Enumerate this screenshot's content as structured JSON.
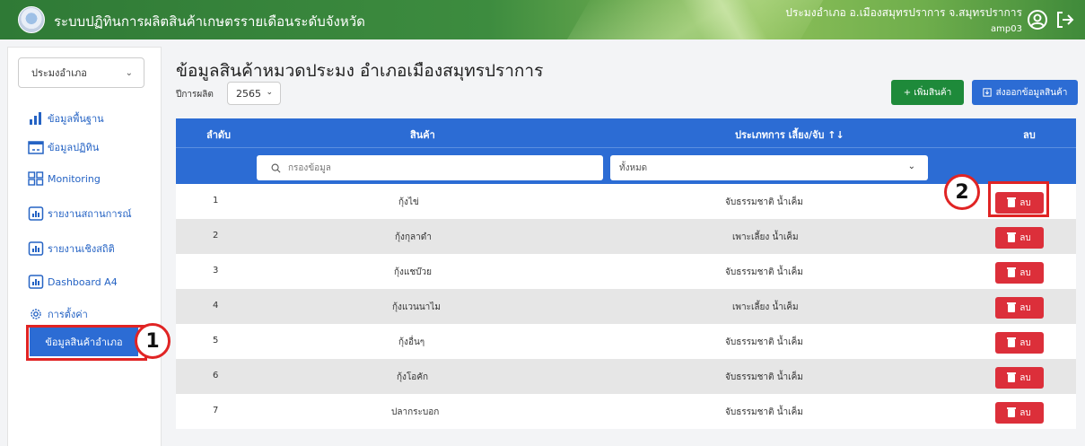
{
  "header": {
    "app_title": "ระบบปฏิทินการผลิตสินค้าเกษตรรายเดือนระดับจังหวัด",
    "user_location": "ประมงอำเภอ อ.เมืองสมุทรปราการ จ.สมุทรปราการ",
    "username": "amp03"
  },
  "sidebar": {
    "select_value": "ประมงอำเภอ",
    "items": [
      {
        "label": "ข้อมูลพื้นฐาน",
        "icon": "bar-chart-icon"
      },
      {
        "label": "ข้อมูลปฏิทิน",
        "icon": "calendar-icon"
      },
      {
        "label": "Monitoring",
        "icon": "grid-icon"
      },
      {
        "label": "รายงานสถานการณ์",
        "icon": "report-chart-icon"
      },
      {
        "label": "รายงานเชิงสถิติ",
        "icon": "report-chart-icon"
      },
      {
        "label": "Dashboard A4",
        "icon": "report-chart-icon"
      },
      {
        "label": "การตั้งค่า",
        "icon": "gear-icon"
      }
    ],
    "active_item": "ข้อมูลสินค้าอำเภอ"
  },
  "main": {
    "title": "ข้อมูลสินค้าหมวดประมง อำเภอเมืองสมุทรปราการ",
    "year_label": "ปีการผลิต",
    "year_value": "2565",
    "add_button": "+ เพิ่มสินค้า",
    "export_button": "ส่งออกข้อมูลสินค้า"
  },
  "table": {
    "headers": {
      "order": "ลำดับ",
      "product": "สินค้า",
      "type": "ประเภทการ เลี้ยง/จับ ↑↓",
      "delete": "ลบ"
    },
    "filter_placeholder": "กรองข้อมูล",
    "filter_select_value": "ทั้งหมด",
    "delete_label": "ลบ",
    "rows": [
      {
        "order": "1",
        "product": "กุ้งไข่",
        "type": "จับธรรมชาติ น้ำเค็ม"
      },
      {
        "order": "2",
        "product": "กุ้งกุลาดำ",
        "type": "เพาะเลี้ยง น้ำเค็ม"
      },
      {
        "order": "3",
        "product": "กุ้งแชบ๊วย",
        "type": "จับธรรมชาติ น้ำเค็ม"
      },
      {
        "order": "4",
        "product": "กุ้งแวนนาไม",
        "type": "เพาะเลี้ยง น้ำเค็ม"
      },
      {
        "order": "5",
        "product": "กุ้งอื่นๆ",
        "type": "จับธรรมชาติ น้ำเค็ม"
      },
      {
        "order": "6",
        "product": "กุ้งโอคัก",
        "type": "จับธรรมชาติ น้ำเค็ม"
      },
      {
        "order": "7",
        "product": "ปลากระบอก",
        "type": "จับธรรมชาติ น้ำเค็ม"
      }
    ]
  },
  "callouts": {
    "one": "1",
    "two": "2"
  },
  "colors": {
    "primary": "#2c6cd4",
    "success": "#1e8a3a",
    "danger": "#dc2f3a",
    "header_green": "#2f7a36",
    "highlight": "#e02424"
  }
}
